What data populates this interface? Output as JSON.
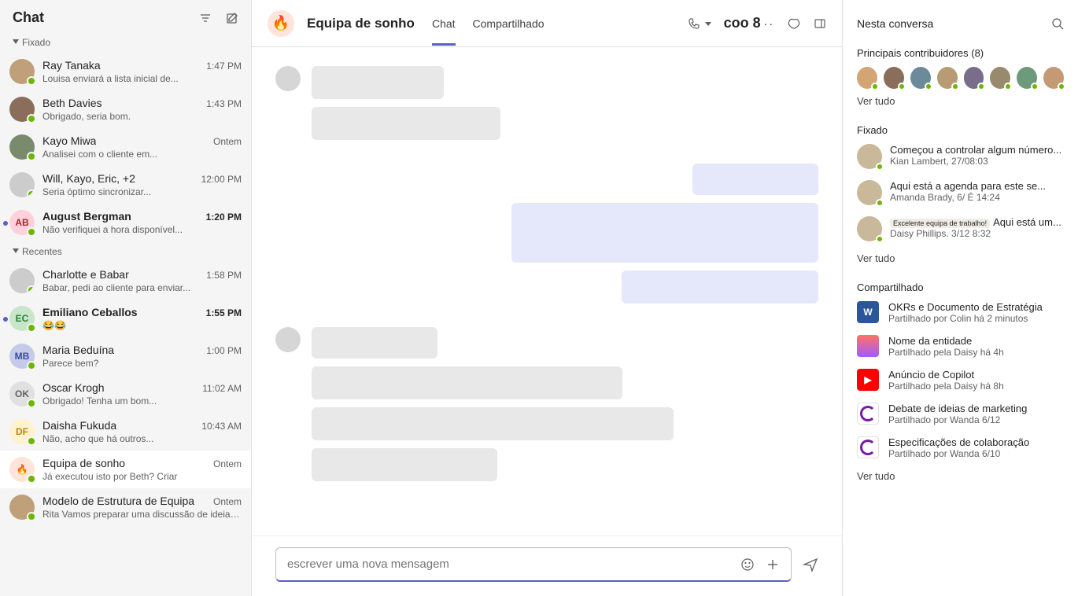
{
  "sidebar": {
    "title": "Chat",
    "sections": {
      "pinned": "Fixado",
      "recent": "Recentes"
    },
    "pinned": [
      {
        "name": "Ray Tanaka",
        "time": "1:47 PM",
        "preview": "Louisa enviará a lista inicial de...",
        "initials": "",
        "color": "#bfa07a"
      },
      {
        "name": "Beth  Davies",
        "time": "1:43 PM",
        "preview": "Obrigado, seria bom.",
        "initials": "",
        "color": "#8a6d5a"
      },
      {
        "name": "Kayo Miwa",
        "time": "Ontem",
        "preview": "Analisei com o cliente em...",
        "initials": "",
        "color": "#7a8a6d"
      },
      {
        "name": "Will, Kayo, Eric, +2",
        "time": "12:00 PM",
        "preview": "Seria óptimo sincronizar...",
        "duo": true
      },
      {
        "name": "August Bergman",
        "time": "1:20 PM",
        "preview": "Não verifiquei a hora disponível...",
        "initials": "AB",
        "color": "#ffd1dc",
        "txtcolor": "#a4262c",
        "bold": true,
        "new": true
      }
    ],
    "recent": [
      {
        "name": "Charlotte e       Babar",
        "time": "1:58 PM",
        "preview": "Babar, pedi ao cliente para enviar...",
        "duo": true
      },
      {
        "name": "Emiliano Ceballos",
        "time": "1:55 PM",
        "preview": "😂😂",
        "initials": "EC",
        "color": "#c8e6c9",
        "txtcolor": "#2e7d32",
        "bold": true,
        "new": true
      },
      {
        "name": "Maria Beduína",
        "time": "1:00 PM",
        "preview": "Parece bem?",
        "initials": "MB",
        "color": "#c5cae9",
        "txtcolor": "#3949ab"
      },
      {
        "name": "Oscar Krogh",
        "time": "11:02 AM",
        "preview": "Obrigado! Tenha um bom...",
        "initials": "OK",
        "color": "#e0e0e0",
        "txtcolor": "#616161"
      },
      {
        "name": "Daisha Fukuda",
        "time": "10:43 AM",
        "preview": "Não, acho que há outros...",
        "initials": "DF",
        "color": "#fff3cd",
        "txtcolor": "#b8860b"
      },
      {
        "name": "Equipa de sonho",
        "time": "Ontem",
        "preview": "Já executou isto por Beth? Criar",
        "emoji": "🔥",
        "color": "#ffe5d9",
        "active": true
      },
      {
        "name": "Modelo de Estrutura de Equipa",
        "time": "Ontem",
        "preview": "Rita Vamos preparar uma discussão de ideias...",
        "color": "#bfa07a"
      }
    ]
  },
  "convo": {
    "emoji": "🔥",
    "title": "Equipa de sonho",
    "tabs": {
      "chat": "Chat",
      "shared": "Compartilhado"
    },
    "member_chip": "coo 8",
    "compose_placeholder": "escrever uma nova mensagem"
  },
  "rpanel": {
    "title": "Nesta conversa",
    "contrib_title": "Principais contribuidores (8)",
    "see_all": "Ver tudo",
    "pinned_title": "Fixado",
    "pinned": [
      {
        "title": "Começou a controlar algum número...",
        "sub": "Kian Lambert, 27/08:03"
      },
      {
        "title": "Aqui está a agenda para este se...",
        "sub": "Amanda Brady, 6/ É 14:24"
      },
      {
        "title": "Aqui está um...",
        "badge": "Excelente equipa de trabalho!",
        "sub": "Daisy Phillips. 3/12 8:32"
      }
    ],
    "shared_title": "Compartilhado",
    "shared": [
      {
        "icon": "word",
        "icon_label": "W",
        "title": "OKRs e Documento de Estratégia",
        "sub": "Partilhado por Colin há 2 minutos"
      },
      {
        "icon": "figma",
        "icon_label": "",
        "title": "Nome da entidade",
        "sub": "Partilhado pela Daisy há 4h"
      },
      {
        "icon": "yt",
        "icon_label": "▶",
        "title": "Anúncio de Copilot",
        "sub": "Partilhado pela Daisy há 8h"
      },
      {
        "icon": "loop",
        "icon_label": "",
        "title": "Debate de ideias de marketing",
        "sub": "Partilhado por Wanda 6/12"
      },
      {
        "icon": "loop",
        "icon_label": "",
        "title": "Especificações de colaboração",
        "sub": "Partilhado por Wanda 6/10"
      }
    ]
  }
}
